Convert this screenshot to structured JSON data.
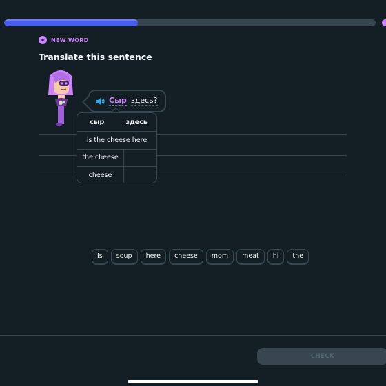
{
  "progress": {
    "fraction": 0.36
  },
  "badge": {
    "label": "NEW WORD"
  },
  "title": "Translate this sentence",
  "prompt": {
    "key_word": "Сыр",
    "rest": "здесь?"
  },
  "hint": {
    "headers": [
      "сыр",
      "здесь"
    ],
    "rows": [
      {
        "type": "full",
        "text": "is the cheese here"
      },
      {
        "type": "left",
        "text": "the cheese"
      },
      {
        "type": "left",
        "text": "cheese"
      }
    ]
  },
  "word_bank": [
    "Is",
    "soup",
    "here",
    "cheese",
    "mom",
    "meat",
    "hi",
    "the"
  ],
  "footer": {
    "check_label": "CHECK"
  },
  "colors": {
    "accent": "#ce82ff",
    "progress": "#4b61ff",
    "background": "#131f24",
    "border": "#37464f"
  }
}
